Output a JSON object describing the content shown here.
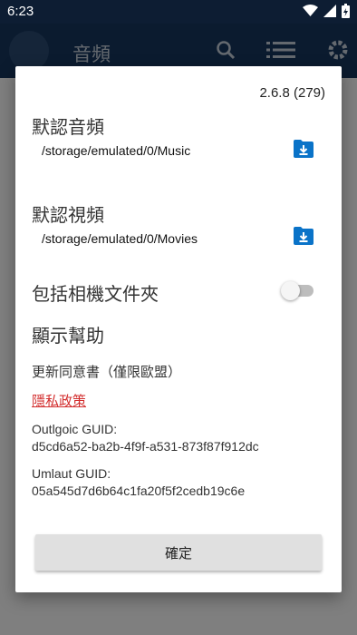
{
  "status_bar": {
    "time": "6:23"
  },
  "app_bar": {
    "title": "音頻"
  },
  "dialog": {
    "version": "2.6.8 (279)",
    "default_audio": {
      "title": "默認音頻",
      "path": "/storage/emulated/0/Music"
    },
    "default_video": {
      "title": "默認視頻",
      "path": "/storage/emulated/0/Movies"
    },
    "include_camera": {
      "label": "包括相機文件夾",
      "enabled": false
    },
    "show_help": "顯示幫助",
    "update_consent": "更新同意書（僅限歐盟）",
    "privacy_policy": "隱私政策",
    "outlgoic_guid": {
      "label": "Outlgoic GUID:",
      "value": "d5cd6a52-ba2b-4f9f-a531-873f87f912dc"
    },
    "umlaut_guid": {
      "label": "Umlaut GUID:",
      "value": "05a545d7d6b64c1fa20f5f2cedb19c6e"
    },
    "ok_label": "確定"
  },
  "colors": {
    "accent": "#0a73c8",
    "link": "#d32f2f",
    "appbar": "#16375f"
  }
}
